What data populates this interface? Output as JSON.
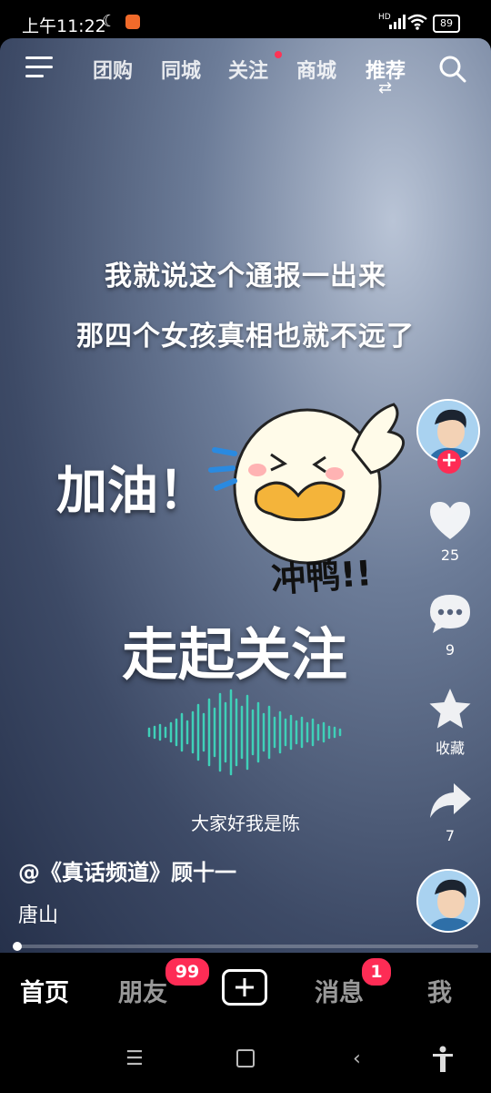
{
  "status_bar": {
    "time": "上午11:22",
    "network": "HD",
    "battery": "89"
  },
  "top_nav": {
    "tabs": [
      "团购",
      "同城",
      "关注",
      "商城",
      "推荐"
    ],
    "active_tab": "推荐",
    "follow_has_dot": true
  },
  "video": {
    "caption_line1": "我就说这个通报一出来",
    "caption_line2": "那四个女孩真相也就不远了",
    "sticker_cheer": "加油！",
    "sticker_rush": "冲鸭!!",
    "sticker_follow": "走起关注",
    "subtitle": "大家好我是陈",
    "author": "@《真话频道》顾十一",
    "location": "唐山",
    "progress_fraction": 0.01
  },
  "side_actions": {
    "likes": "25",
    "comments": "9",
    "favorite_label": "收藏",
    "shares": "7"
  },
  "bottom_nav": {
    "home": "首页",
    "friends": "朋友",
    "friends_badge": "99",
    "messages": "消息",
    "messages_badge": "1",
    "me": "我"
  },
  "colors": {
    "accent": "#fe2c55",
    "wave": "#3fd0b8"
  }
}
